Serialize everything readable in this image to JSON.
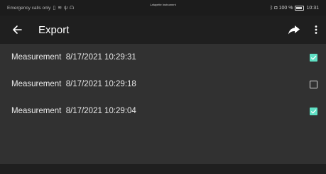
{
  "status_bar": {
    "left_text": "Emergency calls only",
    "center_text": "Lafayette Instrument",
    "battery_text": "100 %",
    "time": "10:31"
  },
  "app_bar": {
    "title": "Export",
    "back_icon": "arrow-left-icon",
    "share_icon": "share-icon",
    "more_icon": "more-vertical-icon"
  },
  "measurements": [
    {
      "label": "Measurement  8/17/2021 10:29:31",
      "checked": true
    },
    {
      "label": "Measurement  8/17/2021 10:29:18",
      "checked": false
    },
    {
      "label": "Measurement  8/17/2021 10:29:04",
      "checked": true
    }
  ],
  "colors": {
    "checkbox_checked": "#5fe0c4",
    "background": "#313131",
    "app_bar": "#1f1f1f"
  }
}
